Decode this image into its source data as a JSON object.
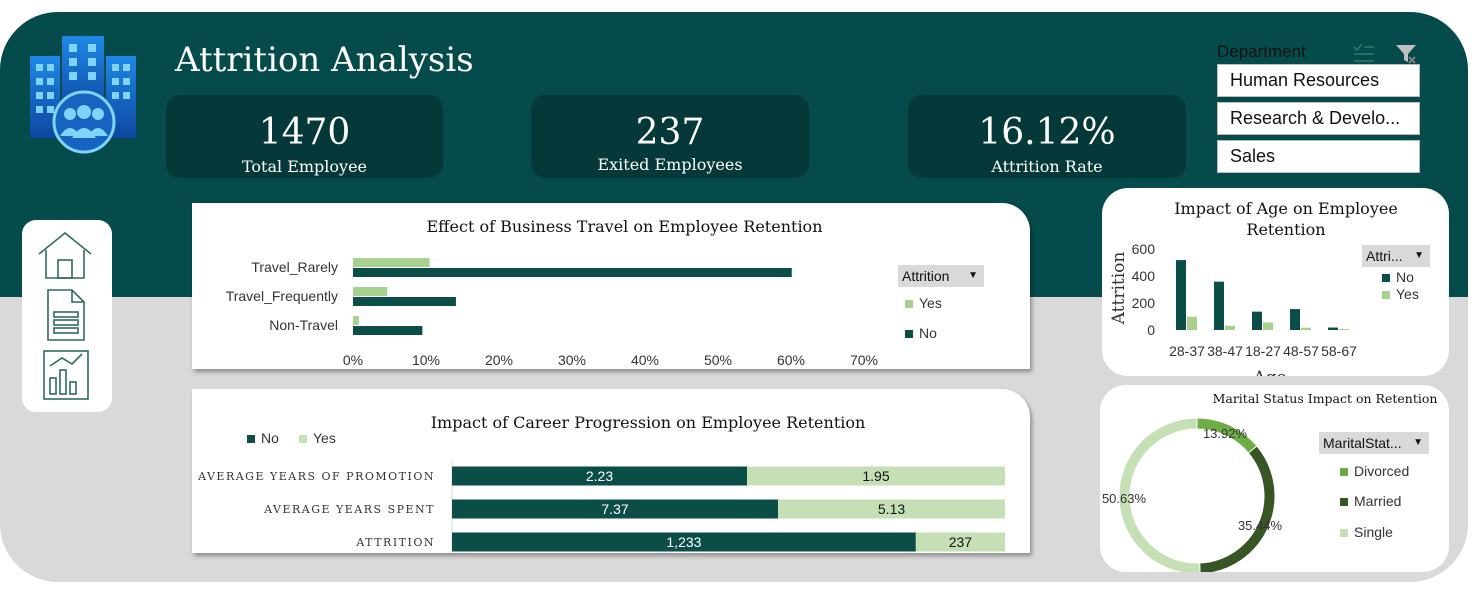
{
  "header": {
    "title": "Attrition Analysis"
  },
  "kpis": [
    {
      "value": "1470",
      "label": "Total Employee"
    },
    {
      "value": "237",
      "label": "Exited Employees"
    },
    {
      "value": "16.12%",
      "label": "Attrition Rate"
    }
  ],
  "slicer": {
    "title": "Department",
    "items": [
      "Human Resources",
      "Research & Develo...",
      "Sales"
    ]
  },
  "colors": {
    "band": "#064b4b",
    "kpi_bg": "#053838",
    "no": "#0b4e48",
    "yes": "#a9d18e",
    "yes_light": "#c5e0b4",
    "married": "#375623",
    "divorced": "#70ad47",
    "single": "#c5e0b4"
  },
  "nav": {
    "icons": [
      "home-icon",
      "document-icon",
      "report-icon"
    ]
  },
  "chart_data": [
    {
      "type": "bar",
      "orientation": "horizontal",
      "title": "Effect of Business Travel on Employee Retention",
      "categories": [
        "Travel_Rarely",
        "Travel_Frequently",
        "Non-Travel"
      ],
      "series": [
        {
          "name": "Yes",
          "values": [
            0.105,
            0.047,
            0.008
          ]
        },
        {
          "name": "No",
          "values": [
            0.601,
            0.141,
            0.095
          ]
        }
      ],
      "xlim": [
        0,
        0.7
      ],
      "x_ticks": [
        "0%",
        "10%",
        "20%",
        "30%",
        "40%",
        "50%",
        "60%",
        "70%"
      ],
      "legend_title": "Attrition",
      "legend": [
        "Yes",
        "No"
      ],
      "legend_position": "right"
    },
    {
      "type": "bar",
      "orientation": "horizontal",
      "stacked": "percent",
      "title": "Impact of Career Progression on Employee Retention",
      "categories": [
        "AVERAGE YEARS OF PROMOTION",
        "AVERAGE YEARS SPENT",
        "ATTRITION"
      ],
      "series": [
        {
          "name": "No",
          "values": [
            2.23,
            7.37,
            1233
          ],
          "labels": [
            "2.23",
            "7.37",
            "1,233"
          ]
        },
        {
          "name": "Yes",
          "values": [
            1.95,
            5.13,
            237
          ],
          "labels": [
            "1.95",
            "5.13",
            "237"
          ]
        }
      ],
      "legend": [
        "No",
        "Yes"
      ],
      "legend_position": "top-left"
    },
    {
      "type": "bar",
      "title": "Impact of Age on Employee Retention",
      "categories": [
        "28-37",
        "38-47",
        "18-27",
        "48-57",
        "58-67"
      ],
      "series": [
        {
          "name": "No",
          "values": [
            518,
            358,
            136,
            155,
            18
          ]
        },
        {
          "name": "Yes",
          "values": [
            98,
            32,
            56,
            17,
            7
          ]
        }
      ],
      "ylim": [
        0,
        600
      ],
      "y_ticks": [
        "0",
        "200",
        "400",
        "600"
      ],
      "xlabel": "Age",
      "ylabel": "Attrition",
      "legend_title": "Attri...",
      "legend": [
        "No",
        "Yes"
      ],
      "legend_position": "right"
    },
    {
      "type": "pie",
      "donut": true,
      "title": "Marital Status Impact on Retention",
      "categories": [
        "Divorced",
        "Married",
        "Single"
      ],
      "values": [
        13.92,
        35.44,
        50.63
      ],
      "labels": [
        "13.92%",
        "35.44%",
        "50.63%"
      ],
      "legend_title": "MaritalStat...",
      "legend": [
        "Divorced",
        "Married",
        "Single"
      ],
      "legend_position": "right"
    }
  ]
}
